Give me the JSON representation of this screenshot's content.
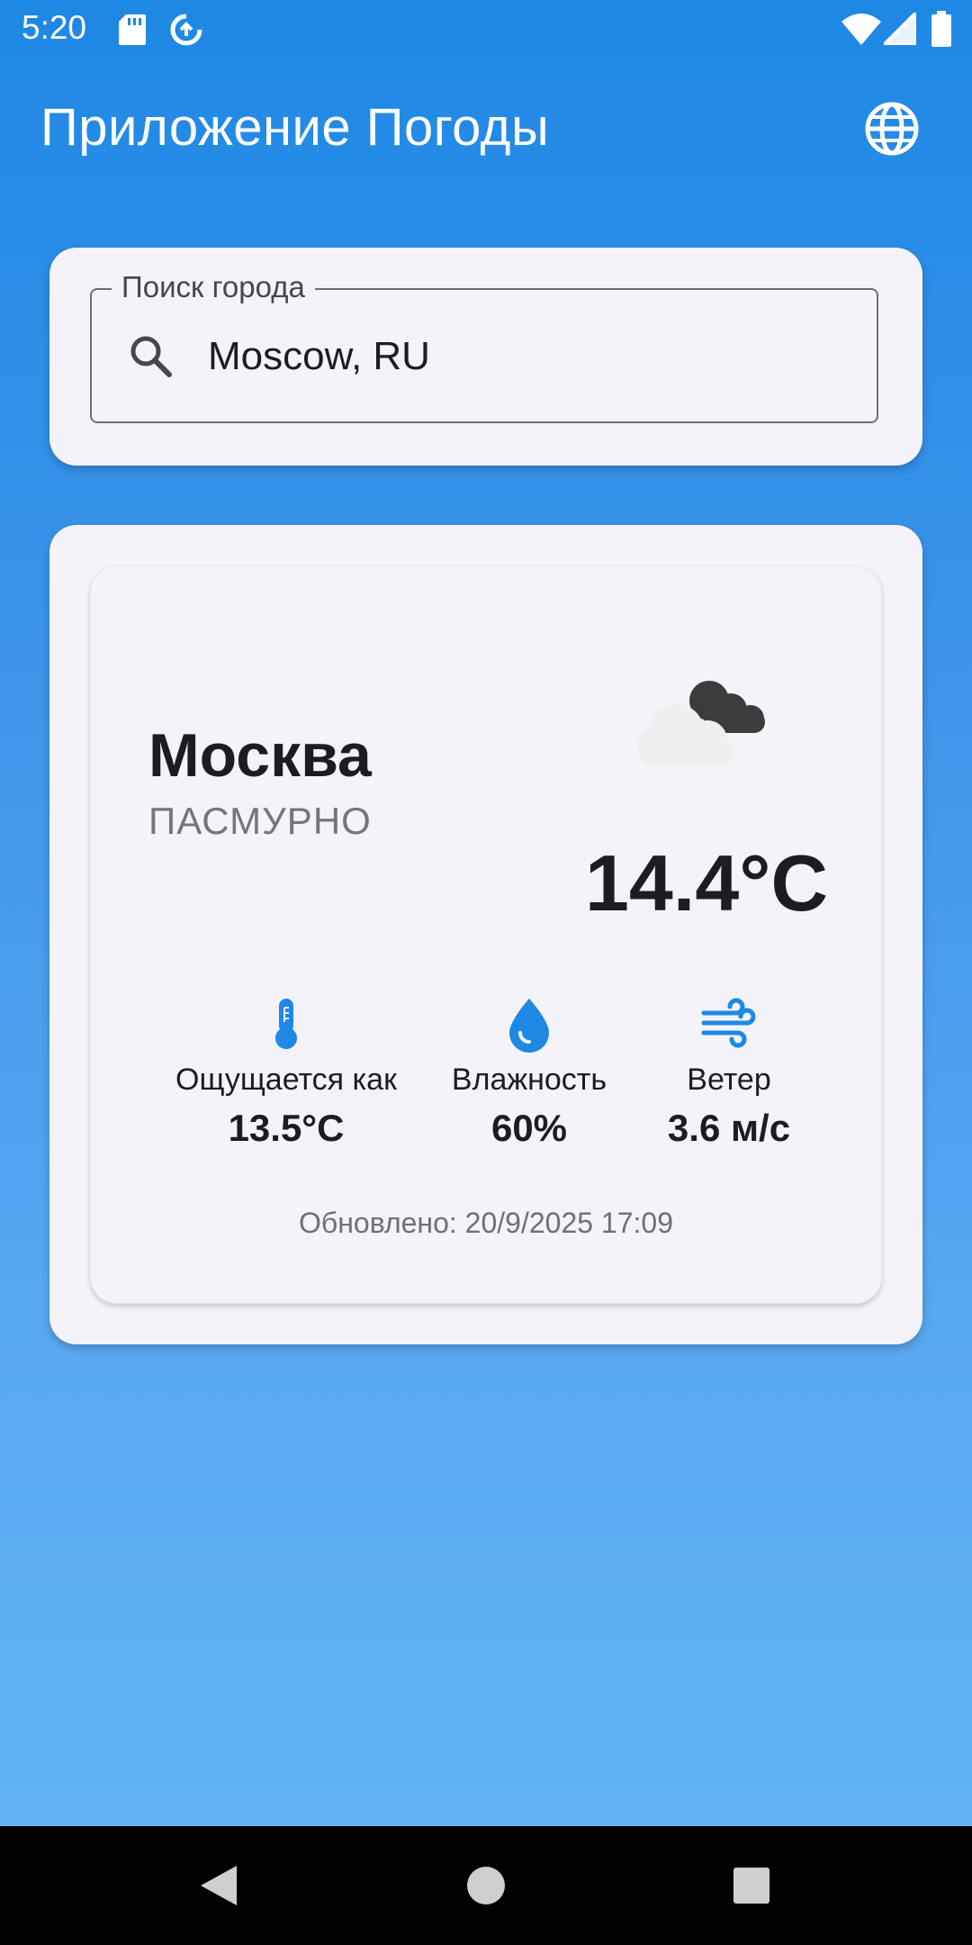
{
  "status_bar": {
    "time": "5:20",
    "left_icons": [
      "sd-card-icon",
      "data-saver-icon"
    ],
    "right_icons": [
      "wifi-icon",
      "signal-icon",
      "battery-icon"
    ]
  },
  "app_bar": {
    "title": "Приложение Погоды",
    "action_icon": "globe-icon"
  },
  "search": {
    "label": "Поиск города",
    "value": "Moscow, RU",
    "icon": "search-icon"
  },
  "weather": {
    "city": "Москва",
    "condition": "ПАСМУРНО",
    "temperature": "14.4°C",
    "icon": "overcast-clouds-icon",
    "metrics": [
      {
        "icon": "thermometer-icon",
        "label": "Ощущается как",
        "value": "13.5°C"
      },
      {
        "icon": "water-drop-icon",
        "label": "Влажность",
        "value": "60%"
      },
      {
        "icon": "wind-icon",
        "label": "Ветер",
        "value": "3.6 м/с"
      }
    ],
    "updated": "Обновлено: 20/9/2025 17:09"
  },
  "colors": {
    "app_bar_blue": "#1e88e5",
    "background_bottom": "#64b5f6",
    "card_background": "#f3f3f9",
    "accent_icon": "#1e88e5",
    "text_primary": "#1c1c22",
    "text_secondary": "#75757c"
  },
  "nav_bar": {
    "buttons": [
      "back-icon",
      "home-icon",
      "recents-icon"
    ]
  }
}
